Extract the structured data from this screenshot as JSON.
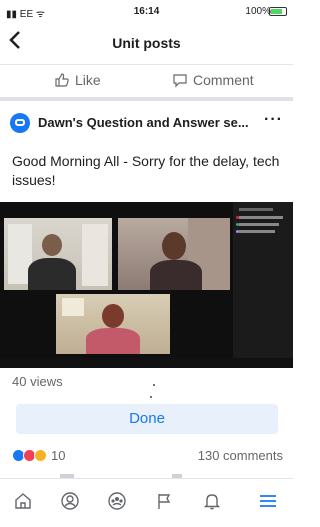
{
  "status_bar": {
    "carrier": "EE",
    "time": "16:14",
    "battery": "100%"
  },
  "header": {
    "title": "Unit posts",
    "back_icon": "chevron-left-icon"
  },
  "actions": {
    "like": "Like",
    "comment": "Comment"
  },
  "post": {
    "group_name": "Dawn's Question and Answer se...",
    "more": "···",
    "text": "Good Morning All - Sorry for the delay, tech issues!",
    "views": "40 views",
    "done_label": "Done",
    "reaction_count": "10",
    "comments_count": "130 comments"
  },
  "tabbar": {
    "items": [
      "home-icon",
      "profile-icon",
      "groups-icon",
      "pages-icon",
      "notifications-icon",
      "menu-icon"
    ],
    "active": "menu-icon"
  },
  "colors": {
    "accent": "#1877f2",
    "done_bg": "#e7f0fb",
    "text_secondary": "#65676b"
  }
}
